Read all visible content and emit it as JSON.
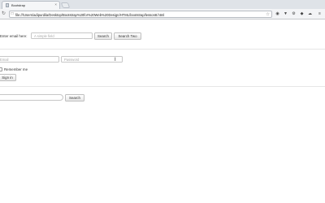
{
  "browser": {
    "tab_title": "Bootstrap",
    "tab_close": "×",
    "url": "file:///Users/adipurdila/Desktop/Bootstrap%20for%20Web%20Design/HTML/bootstrap/lesson8.html",
    "icons": [
      "back-icon",
      "reload-icon",
      "star-icon",
      "extension-icons"
    ]
  },
  "inline_form": {
    "label": "Enter email here:",
    "input_placeholder": "A simple field",
    "search_button": "Search",
    "search_two_button": "Search Two"
  },
  "signin_form": {
    "email_placeholder": "Email",
    "password_placeholder": "Password",
    "remember_label": "Remember me",
    "submit_button": "Sign in"
  },
  "search_form": {
    "input_placeholder": "",
    "search_button": "Search"
  }
}
